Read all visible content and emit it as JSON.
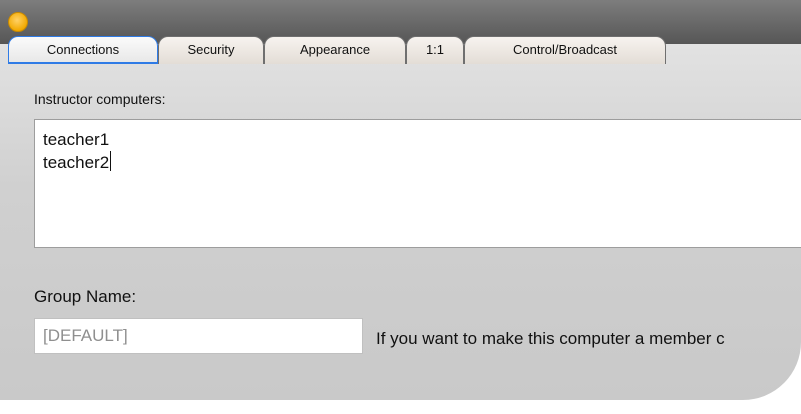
{
  "tabs": {
    "connections": "Connections",
    "security": "Security",
    "appearance": "Appearance",
    "one_to_one": "1:1",
    "control_broadcast": "Control/Broadcast"
  },
  "instructor": {
    "label": "Instructor computers:",
    "lines": [
      "teacher1",
      "teacher2"
    ]
  },
  "group": {
    "label": "Group Name:",
    "value": "[DEFAULT]",
    "help_text": "If you want to make this computer a member c"
  },
  "colors": {
    "accent": "#2f7be6",
    "traffic_light": "#f2a900"
  }
}
